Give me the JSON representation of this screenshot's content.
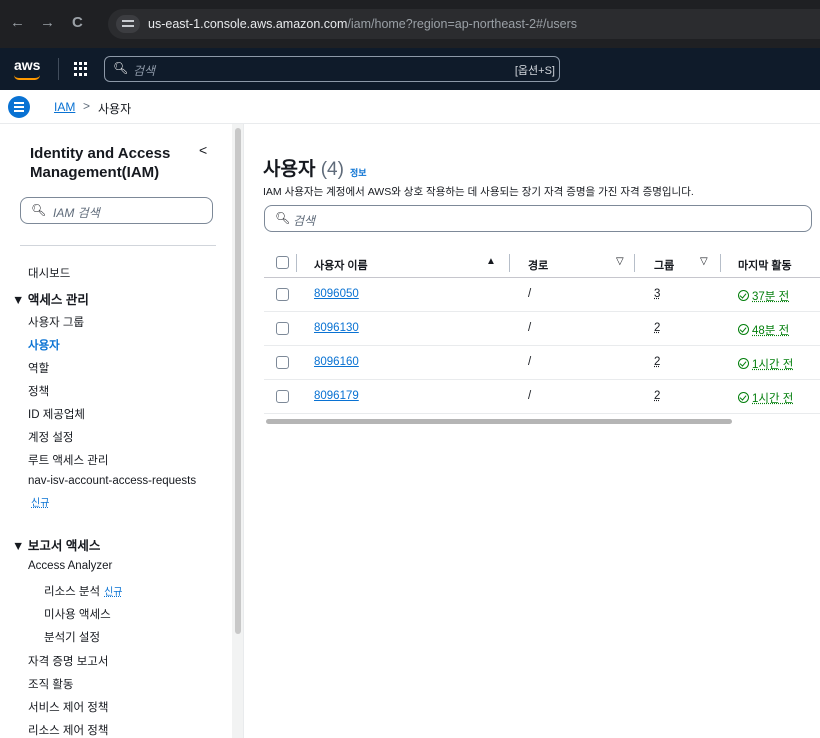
{
  "browser": {
    "back": "←",
    "forward": "→",
    "reload": "C",
    "url_host": "us-east-1.console.aws.amazon.com",
    "url_path": "/iam/home?region=ap-northeast-2#/users"
  },
  "aws_header": {
    "logo": "aws",
    "search_placeholder": "검색",
    "search_shortcut": "[옵션+S]"
  },
  "breadcrumb": {
    "root": "IAM",
    "separator": ">",
    "current": "사용자"
  },
  "sidebar": {
    "title": "Identity and Access Management(IAM)",
    "collapse": "<",
    "search_placeholder": "IAM 검색",
    "dashboard": "대시보드",
    "access_mgmt": {
      "label": "액세스 관리",
      "items": [
        "사용자 그룹",
        "사용자",
        "역할",
        "정책",
        "ID 제공업체",
        "계정 설정",
        "루트 액세스 관리",
        "nav-isv-account-access-requests"
      ],
      "new_badge": "신규"
    },
    "reports": {
      "label": "보고서 액세스",
      "access_analyzer": "Access Analyzer",
      "analyzer_items": [
        "리소스 분석",
        "미사용 액세스",
        "분석기 설정"
      ],
      "resource_badge": "신규",
      "items": [
        "자격 증명 보고서",
        "조직 활동",
        "서비스 제어 정책",
        "리소스 제어 정책"
      ]
    }
  },
  "main": {
    "title": "사용자",
    "count": "(4)",
    "info": "정보",
    "description": "IAM 사용자는 계정에서 AWS와 상호 작용하는 데 사용되는 장기 자격 증명을 가진 자격 증명입니다.",
    "search_placeholder": "검색",
    "columns": [
      "사용자 이름",
      "경로",
      "그룹",
      "마지막 활동"
    ],
    "sort_asc": "▲",
    "sort_desc": "▽",
    "rows": [
      {
        "name": "8096050",
        "path": "/",
        "groups": "3",
        "activity": "37분 전"
      },
      {
        "name": "8096130",
        "path": "/",
        "groups": "2",
        "activity": "48분 전"
      },
      {
        "name": "8096160",
        "path": "/",
        "groups": "2",
        "activity": "1시간 전"
      },
      {
        "name": "8096179",
        "path": "/",
        "groups": "2",
        "activity": "1시간 전"
      }
    ]
  },
  "colors": {
    "link": "#0972d3",
    "success": "#037f0c",
    "header_bg": "#0f1b2a",
    "brand_accent": "#ff9900"
  }
}
